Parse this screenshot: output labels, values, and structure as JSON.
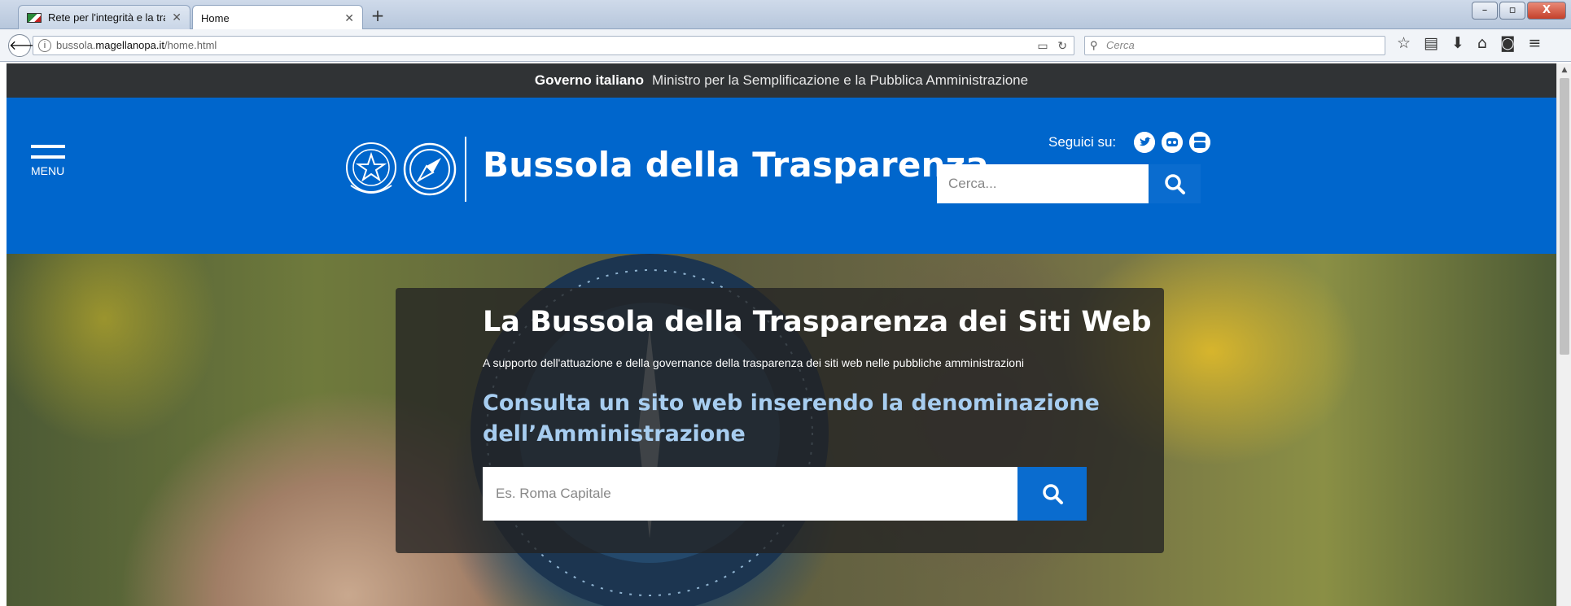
{
  "browser": {
    "tabs": [
      {
        "title": "Rete per l'integrità e la tras...",
        "active": false
      },
      {
        "title": "Home",
        "active": true
      }
    ],
    "new_tab": "+",
    "url_host_prefix": "bussola.",
    "url_host": "magellanopa.it",
    "url_path": "/home.html",
    "search_placeholder": "Cerca",
    "window_buttons": [
      "–",
      "▫",
      "X"
    ]
  },
  "gov_bar": {
    "brand": "Governo italiano",
    "ministry": "Ministro per la Semplificazione e la Pubblica Amministrazione"
  },
  "header": {
    "menu_label": "MENU",
    "site_title": "Bussola della Trasparenza",
    "social_label": "Seguici su:",
    "social_icons": [
      "twitter-icon",
      "flickr-icon",
      "youtube-icon"
    ],
    "search_placeholder": "Cerca..."
  },
  "hero": {
    "title": "La Bussola della Trasparenza dei Siti Web",
    "subtitle": "A supporto dell'attuazione e della governance della trasparenza dei siti web nelle pubbliche amministrazioni",
    "lead": "Consulta un sito web inserendo la denominazione dell’Amministrazione",
    "search_placeholder": "Es. Roma Capitale"
  },
  "colors": {
    "header_blue": "#0066cc",
    "gov_bar": "#303335",
    "button_blue": "#0a6ccf",
    "lead_text": "#a7cdf0"
  }
}
